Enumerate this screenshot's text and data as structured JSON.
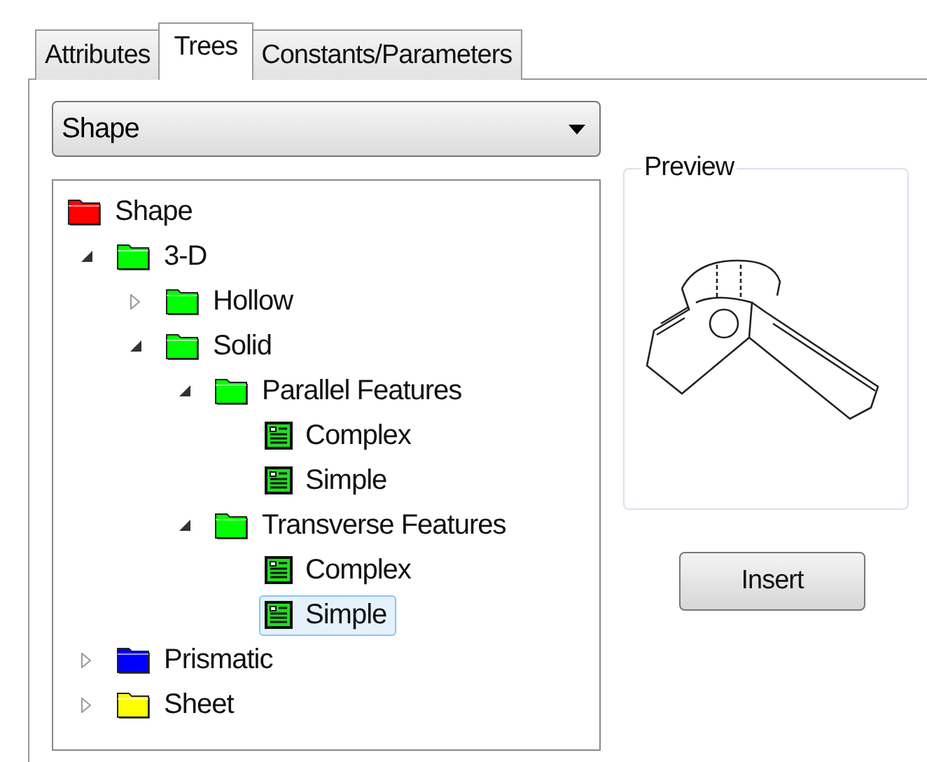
{
  "tabs": [
    {
      "label": "Attributes",
      "selected": false
    },
    {
      "label": "Trees",
      "selected": true
    },
    {
      "label": "Constants/Parameters",
      "selected": false
    }
  ],
  "dropdown": {
    "value": "Shape"
  },
  "tree": [
    {
      "label": "Shape",
      "kind": "folder",
      "color": "#ff0000",
      "selected": false,
      "children": [
        {
          "label": "3-D",
          "kind": "folder",
          "color": "#00ff00",
          "expanded": true,
          "selected": false,
          "children": [
            {
              "label": "Hollow",
              "kind": "folder",
              "color": "#00ff00",
              "expanded": false,
              "selected": false
            },
            {
              "label": "Solid",
              "kind": "folder",
              "color": "#00ff00",
              "expanded": true,
              "selected": false,
              "children": [
                {
                  "label": "Parallel Features",
                  "kind": "folder",
                  "color": "#00ff00",
                  "expanded": true,
                  "selected": false,
                  "children": [
                    {
                      "label": "Complex",
                      "kind": "item",
                      "selected": false
                    },
                    {
                      "label": "Simple",
                      "kind": "item",
                      "selected": false
                    }
                  ]
                },
                {
                  "label": "Transverse Features",
                  "kind": "folder",
                  "color": "#00ff00",
                  "expanded": true,
                  "selected": false,
                  "children": [
                    {
                      "label": "Complex",
                      "kind": "item",
                      "selected": false
                    },
                    {
                      "label": "Simple",
                      "kind": "item",
                      "selected": true
                    }
                  ]
                }
              ]
            }
          ]
        },
        {
          "label": "Prismatic",
          "kind": "folder",
          "color": "#0000ff",
          "expanded": false,
          "selected": false
        },
        {
          "label": "Sheet",
          "kind": "folder",
          "color": "#ffff00",
          "expanded": false,
          "selected": false
        }
      ]
    }
  ],
  "preview": {
    "title": "Preview"
  },
  "insert_button": "Insert"
}
